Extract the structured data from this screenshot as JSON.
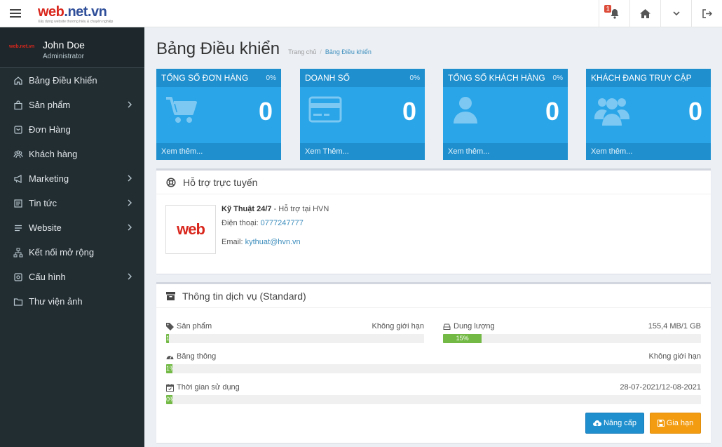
{
  "header": {
    "logo_text_part1": "web",
    "logo_text_part2": ".net.vn",
    "logo_subtitle": "Xây dựng website thương hiệu & chuyên nghiệp",
    "notification_count": "1"
  },
  "sidebar": {
    "logo_text": "web.net.vn",
    "user_name": "John Doe",
    "user_role": "Administrator",
    "items": [
      {
        "label": "Bảng Điều Khiển",
        "icon": "home-icon"
      },
      {
        "label": "Sản phẩm",
        "icon": "bag-icon"
      },
      {
        "label": "Đơn Hàng",
        "icon": "order-icon"
      },
      {
        "label": "Khách hàng",
        "icon": "users-icon"
      },
      {
        "label": "Marketing",
        "icon": "bullhorn-icon"
      },
      {
        "label": "Tin tức",
        "icon": "news-icon"
      },
      {
        "label": "Website",
        "icon": "list-icon"
      },
      {
        "label": "Kết nối mở rộng",
        "icon": "sitemap-icon"
      },
      {
        "label": "Cấu hình",
        "icon": "settings-icon"
      },
      {
        "label": "Thư viện ảnh",
        "icon": "folder-icon"
      }
    ]
  },
  "page": {
    "title": "Bảng Điều khiển",
    "breadcrumb_home": "Trang chủ",
    "breadcrumb_sep": "/",
    "breadcrumb_current": "Bảng Điều khiển"
  },
  "stats": [
    {
      "title": "TỔNG SỐ ĐƠN HÀNG",
      "percent": "0%",
      "value": "0",
      "footer": "Xem thêm..."
    },
    {
      "title": "DOANH SỐ",
      "percent": "0%",
      "value": "0",
      "footer": "Xem Thêm..."
    },
    {
      "title": "TỔNG SỐ KHÁCH HÀNG",
      "percent": "0%",
      "value": "0",
      "footer": "Xem thêm..."
    },
    {
      "title": "KHÁCH ĐANG TRUY CẬP",
      "percent": "",
      "value": "0",
      "footer": "Xem thêm..."
    }
  ],
  "support": {
    "title": "Hỗ trợ trực tuyến",
    "logo_text": "web",
    "name": "Kỹ Thuật 24/7",
    "name_suffix": " - Hỗ trợ tại HVN",
    "phone_label": "Điện thoại: ",
    "phone": "0777247777",
    "email_label": "Email: ",
    "email": "kythuat@hvn.vn"
  },
  "service": {
    "title": "Thông tin dịch vụ (Standard)",
    "products_label": "Sản phẩm",
    "products_value": "Không giới hạn",
    "products_bar_text": "1%",
    "products_percent": 1,
    "storage_label": "Dung lượng",
    "storage_value": "155,4 MB/1 GB",
    "storage_bar_text": "15%",
    "storage_percent": 15,
    "bandwidth_label": "Băng thông",
    "bandwidth_value": "Không giới hạn",
    "bandwidth_bar_text": "1%",
    "bandwidth_percent": 1,
    "time_label": "Thời gian sử dụng",
    "time_value": "28-07-2021/12-08-2021",
    "time_bar_text": "0%",
    "time_percent": 0,
    "upgrade_label": "Nâng cấp",
    "renew_label": "Gia hạn"
  },
  "colors": {
    "sidebar_bg": "#222d32",
    "stat_bg": "#29a5e8",
    "progress": "#72b945",
    "btn_primary": "#1f8fce",
    "btn_warning": "#f39c12"
  }
}
